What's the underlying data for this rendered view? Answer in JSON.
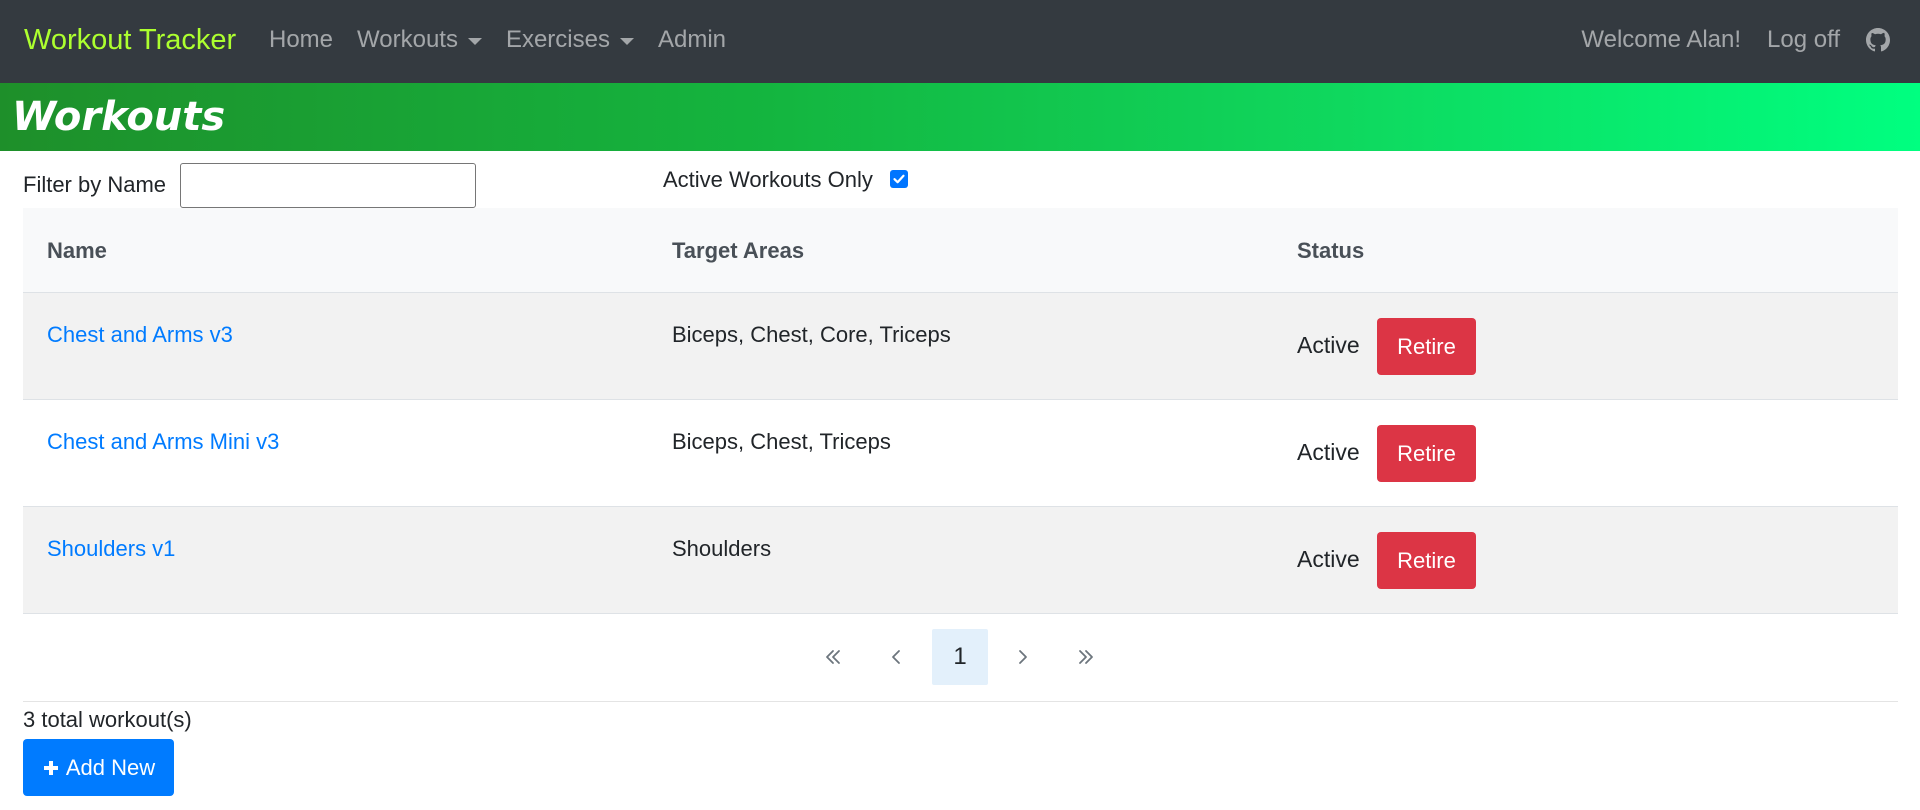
{
  "navbar": {
    "brand": "Workout Tracker",
    "links": {
      "home": "Home",
      "workouts": "Workouts",
      "exercises": "Exercises",
      "admin": "Admin"
    },
    "welcome": "Welcome Alan!",
    "logoff": "Log off",
    "github_icon": "github-icon"
  },
  "banner": {
    "title": "Workouts"
  },
  "filters": {
    "name_label": "Filter by Name",
    "name_value": "",
    "active_label": "Active Workouts Only",
    "active_checked": true
  },
  "table": {
    "headers": {
      "name": "Name",
      "target": "Target Areas",
      "status": "Status"
    },
    "rows": [
      {
        "name": "Chest and Arms v3",
        "target": "Biceps, Chest, Core, Triceps",
        "status": "Active",
        "action": "Retire"
      },
      {
        "name": "Chest and Arms Mini v3",
        "target": "Biceps, Chest, Triceps",
        "status": "Active",
        "action": "Retire"
      },
      {
        "name": "Shoulders v1",
        "target": "Shoulders",
        "status": "Active",
        "action": "Retire"
      }
    ]
  },
  "pagination": {
    "current_page": "1"
  },
  "footer": {
    "total": "3 total workout(s)",
    "add_label": "Add New"
  },
  "colors": {
    "brand": "#adff2f",
    "navbar_bg": "#343a40",
    "link": "#007bff",
    "danger": "#dc3545",
    "primary": "#007bff"
  }
}
